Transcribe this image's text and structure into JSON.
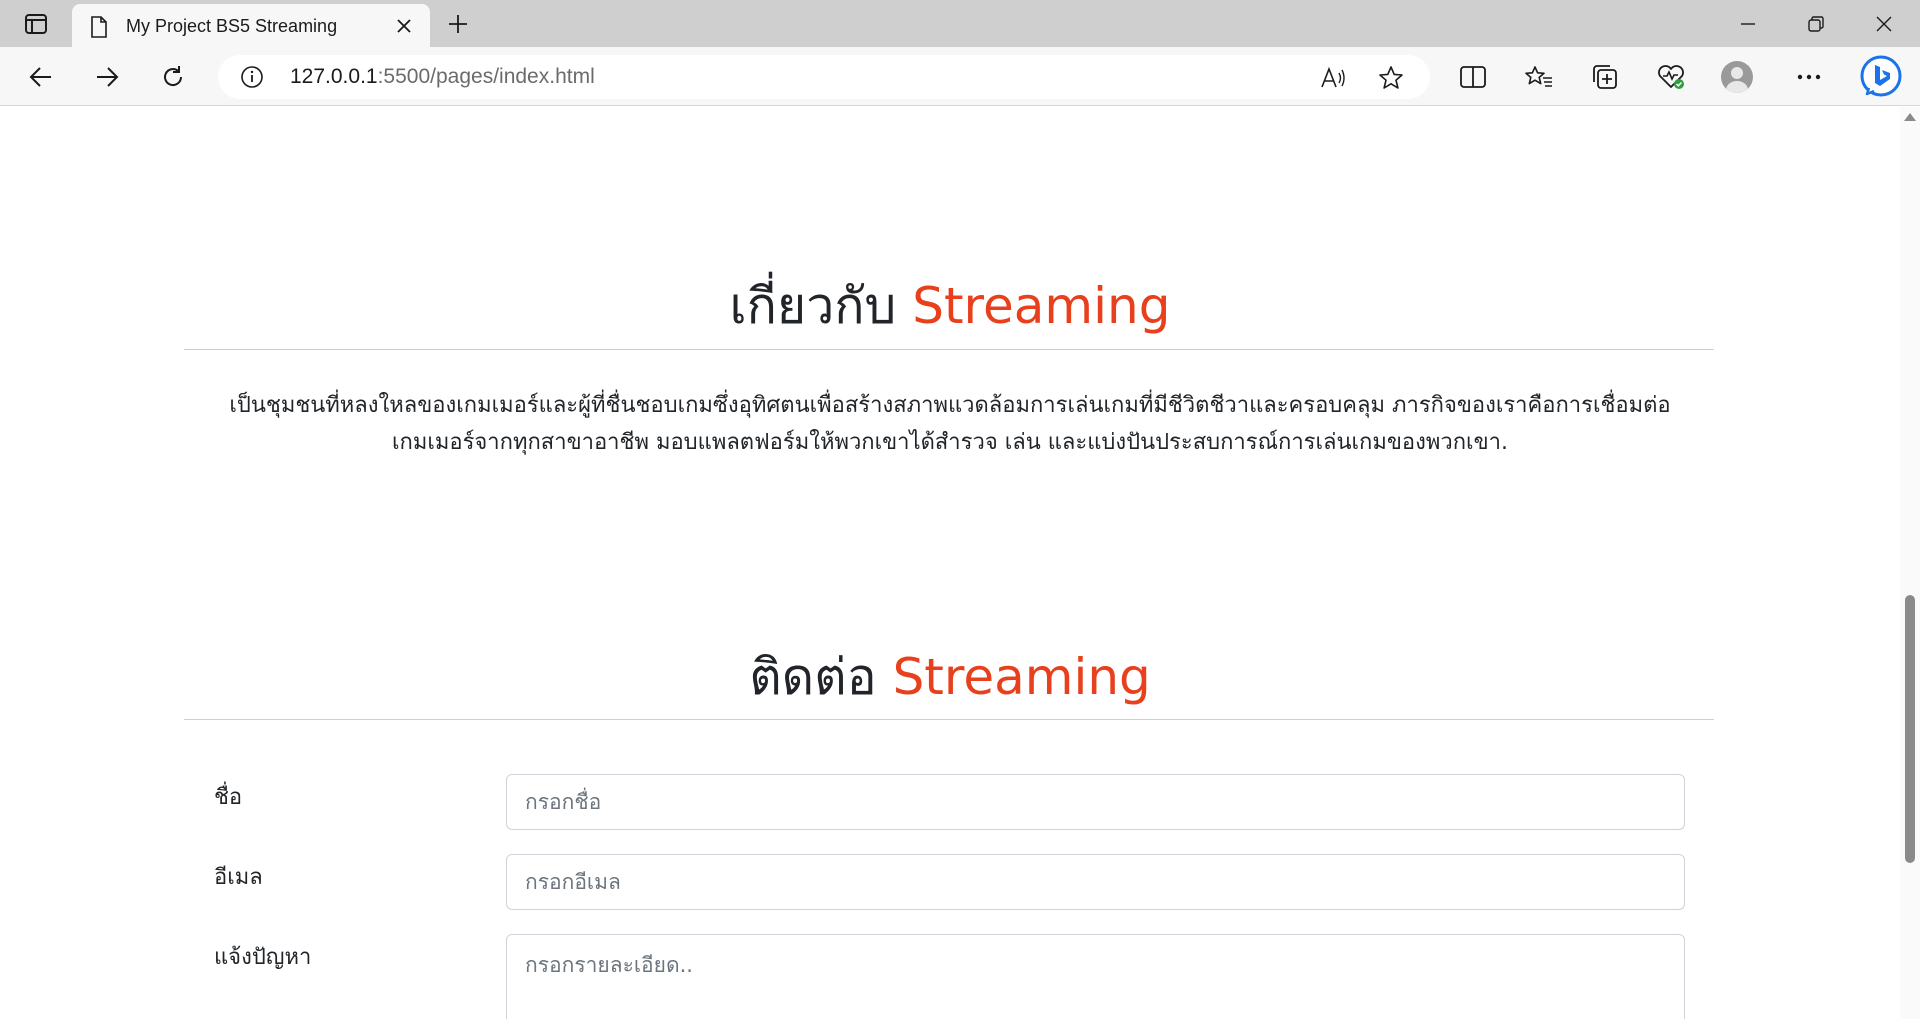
{
  "browser": {
    "tab_title": "My Project BS5 Streaming",
    "url_host": "127.0.0.1",
    "url_rest": ":5500/pages/index.html"
  },
  "about": {
    "title_prefix": "เกี่ยวกับ",
    "title_accent": "Streaming",
    "description_line1": "เป็นชุมชนที่หลงใหลของเกมเมอร์และผู้ที่ชื่นชอบเกมซึ่งอุทิศตนเพื่อสร้างสภาพแวดล้อมการเล่นเกมที่มีชีวิตชีวาและครอบคลุม ภารกิจของเราคือการเชื่อมต่อ",
    "description_line2": "เกมเมอร์จากทุกสาขาอาชีพ มอบแพลตฟอร์มให้พวกเขาได้สำรวจ เล่น และแบ่งปันประสบการณ์การเล่นเกมของพวกเขา."
  },
  "contact": {
    "title_prefix": "ติดต่อ",
    "title_accent": "Streaming",
    "name_label": "ชื่อ",
    "name_placeholder": "กรอกชื่อ",
    "email_label": "อีเมล",
    "email_placeholder": "กรอกอีเมล",
    "issue_label": "แจ้งปัญหา",
    "issue_placeholder": "กรอกรายละเอียด.."
  },
  "colors": {
    "accent": "#e8401c"
  }
}
